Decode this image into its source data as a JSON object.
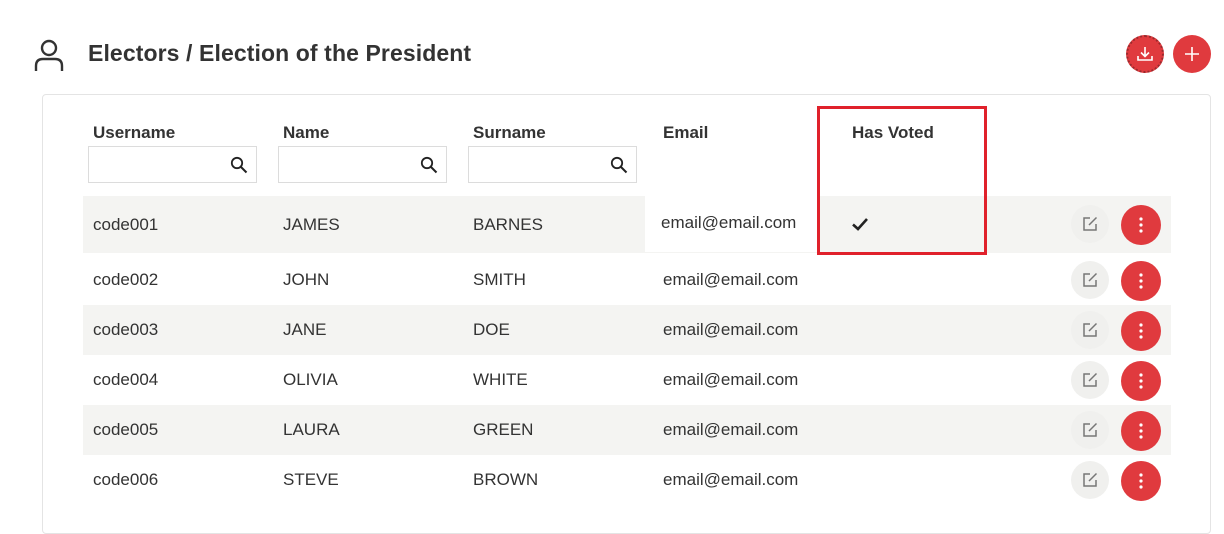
{
  "header": {
    "title": "Electors / Election of the President"
  },
  "icons": {
    "user": "user-icon",
    "download": "download-icon",
    "add": "plus-icon",
    "search": "search-icon",
    "check": "check-icon",
    "edit": "edit-icon",
    "more": "more-vertical-icon"
  },
  "colors": {
    "accent": "#e03a3e",
    "highlight": "#e0212b",
    "row_shade": "#f4f4f2"
  },
  "table": {
    "columns": [
      {
        "label": "Username",
        "filter": true
      },
      {
        "label": "Name",
        "filter": true
      },
      {
        "label": "Surname",
        "filter": true
      },
      {
        "label": "Email",
        "filter": false
      },
      {
        "label": "Has Voted",
        "filter": false
      }
    ],
    "rows": [
      {
        "username": "code001",
        "name": "JAMES",
        "surname": "BARNES",
        "email": "email@email.com",
        "has_voted": true
      },
      {
        "username": "code002",
        "name": "JOHN",
        "surname": "SMITH",
        "email": "email@email.com",
        "has_voted": false
      },
      {
        "username": "code003",
        "name": "JANE",
        "surname": "DOE",
        "email": "email@email.com",
        "has_voted": false
      },
      {
        "username": "code004",
        "name": "OLIVIA",
        "surname": "WHITE",
        "email": "email@email.com",
        "has_voted": false
      },
      {
        "username": "code005",
        "name": "LAURA",
        "surname": "GREEN",
        "email": "email@email.com",
        "has_voted": false
      },
      {
        "username": "code006",
        "name": "STEVE",
        "surname": "BROWN",
        "email": "email@email.com",
        "has_voted": false
      }
    ]
  }
}
